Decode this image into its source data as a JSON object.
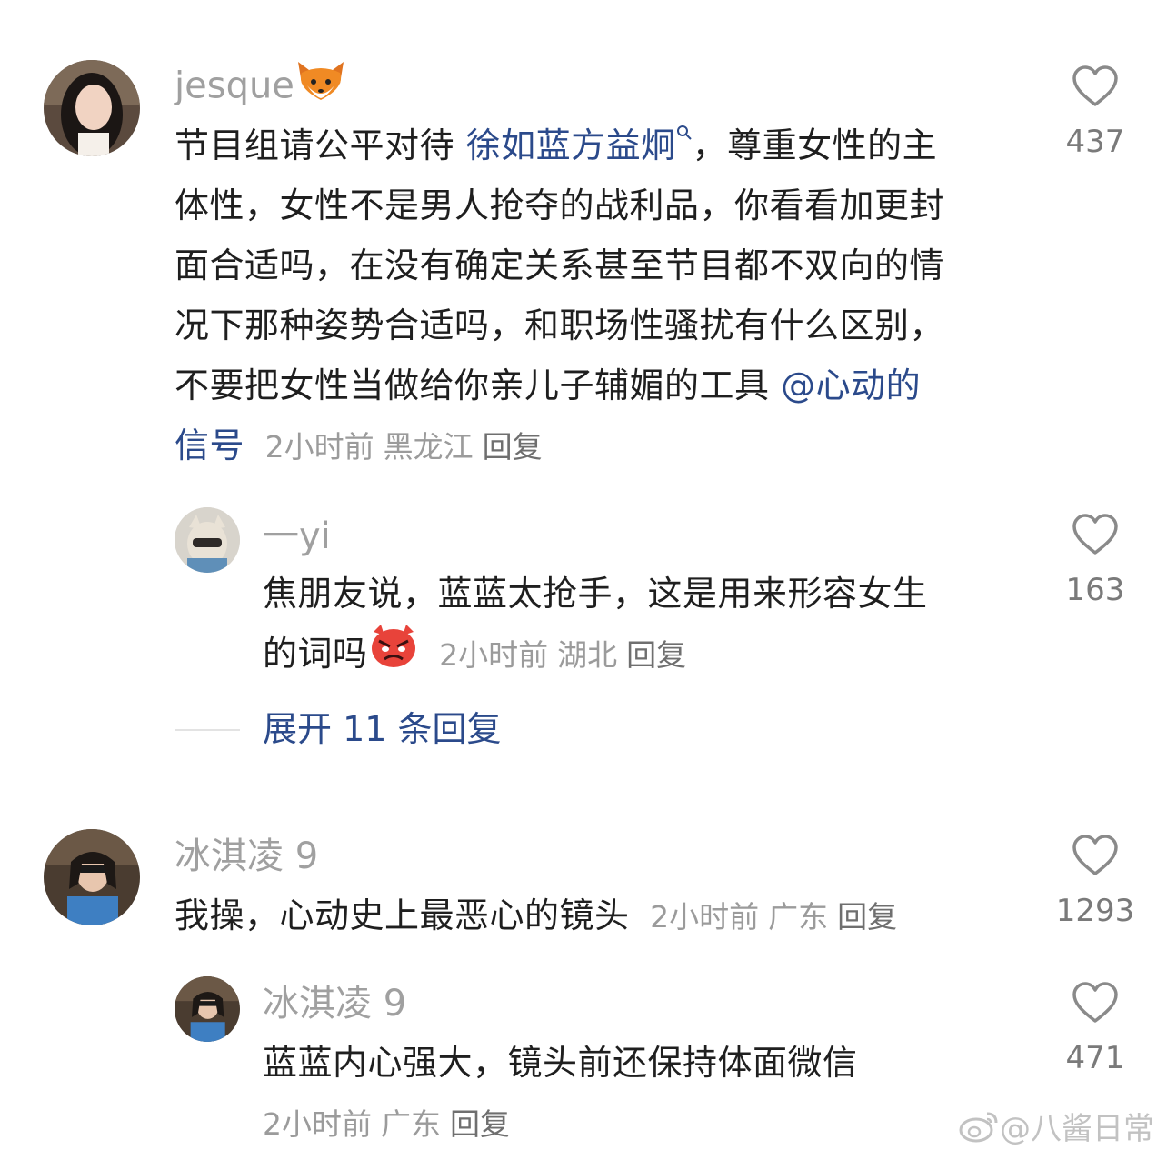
{
  "comments": [
    {
      "username": "jesque",
      "username_emoji": "fox-face",
      "text_before_link": "节目组请公平对待 ",
      "link_text": "徐如蓝方益炯",
      "text_lines": [
        "，尊重女性的主",
        "体性，女性不是男人抢夺的战利品，你看看加更封",
        "面合适吗，在没有确定关系甚至节目都不双向的情",
        "况下那种姿势合适吗，和职场性骚扰有什么区别，",
        "不要把女性当做给你亲儿子辅媚的工具 "
      ],
      "mention_line1": "@心动的",
      "mention_line2": "信号",
      "time": "2小时前",
      "location": "黑龙江",
      "reply_label": "回复",
      "likes": "437"
    },
    {
      "username": "一yi",
      "text_line1": "焦朋友说，蓝蓝太抢手，这是用来形容女生",
      "text_line2": "的词吗",
      "text_emoji": "angry-face",
      "time": "2小时前",
      "location": "湖北",
      "reply_label": "回复",
      "likes": "163"
    },
    {
      "username": "冰淇凌 9",
      "text": "我操，心动史上最恶心的镜头",
      "time": "2小时前",
      "location": "广东",
      "reply_label": "回复",
      "likes": "1293"
    },
    {
      "username": "冰淇凌 9",
      "text": "蓝蓝内心强大，镜头前还保持体面微信",
      "time": "2小时前",
      "location": "广东",
      "reply_label": "回复",
      "likes": "471"
    }
  ],
  "expand_replies": "展开 11 条回复",
  "watermark": "@八酱日常",
  "icons": {
    "like": "heart-outline-icon",
    "search_hint": "search-icon",
    "watermark_logo": "weibo-logo"
  },
  "colors": {
    "link": "#2b4a8b",
    "username": "#a0a0a0",
    "meta": "#9b9b9b"
  }
}
